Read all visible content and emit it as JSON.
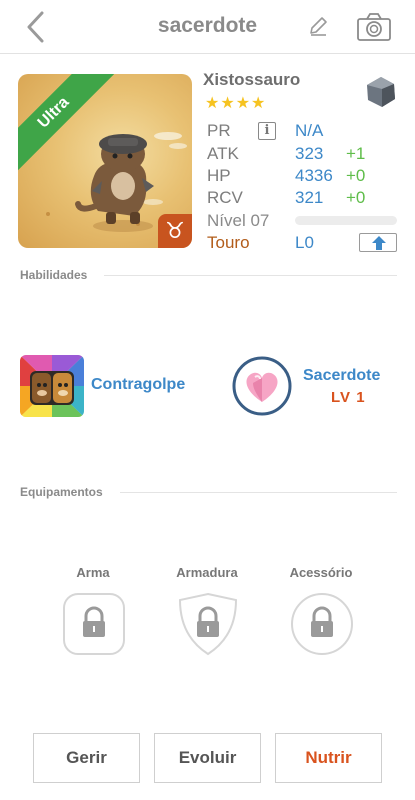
{
  "header": {
    "title": "sacerdote"
  },
  "monster": {
    "rarity": "Ultra",
    "name": "Xistossauro",
    "stars": "★★★★",
    "stats": [
      {
        "label": "PR",
        "value": "N/A",
        "bonus": ""
      },
      {
        "label": "ATK",
        "value": "323",
        "bonus": "+1"
      },
      {
        "label": "HP",
        "value": "4336",
        "bonus": "+0"
      },
      {
        "label": "RCV",
        "value": "321",
        "bonus": "+0"
      }
    ],
    "level_label": "Nível 07",
    "xp_fraction": 0.0,
    "sign_label": "Touro",
    "sign_value": "L0",
    "zodiac_glyph": "♉"
  },
  "abilities": {
    "title": "Habilidades",
    "skill1": {
      "name": "Contragolpe",
      "icon": "paw-split-icon"
    },
    "skill2": {
      "name": "Sacerdote",
      "level": "LV 1",
      "icon": "heart-icon"
    }
  },
  "equipment": {
    "title": "Equipamentos",
    "slots": [
      "Arma",
      "Armadura",
      "Acessório"
    ]
  },
  "actions": {
    "manage": "Gerir",
    "evolve": "Evoluir",
    "feed": "Nutrir"
  },
  "colors": {
    "accent_blue": "#3d88c8",
    "bonus_green": "#5fbd4a",
    "orange": "#d9531e",
    "rarity_green": "#3fa548"
  }
}
